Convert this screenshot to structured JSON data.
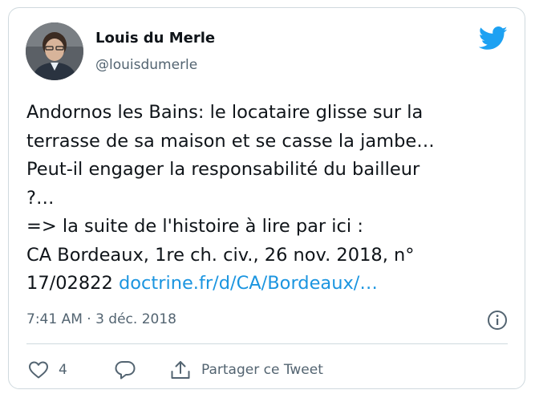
{
  "author": {
    "name": "Louis du Merle",
    "handle": "@louisdumerle"
  },
  "tweet": {
    "text": "Andornos les Bains: le locataire glisse sur la\nterrasse de sa maison et se casse la jambe…\nPeut-il engager la responsabilité du bailleur\n?…\n=> la suite de l'histoire à lire par ici :\nCA Bordeaux, 1re ch. civ., 26 nov. 2018, n°\n17/02822 ",
    "link": "doctrine.fr/d/CA/Bordeaux/…",
    "timestamp": "7:41 AM · 3 déc. 2018"
  },
  "actions": {
    "like_count": "4",
    "share_label": "Partager ce Tweet"
  },
  "icons": {
    "brand": "twitter-bird-icon",
    "info": "info-icon",
    "like": "heart-icon",
    "reply": "speech-bubble-icon",
    "share": "share-upload-icon"
  },
  "colors": {
    "brand_blue": "#1da1f2",
    "link_blue": "#1b95e0",
    "text": "#0f1419",
    "secondary_text": "#536471",
    "border": "#cfd9de"
  }
}
